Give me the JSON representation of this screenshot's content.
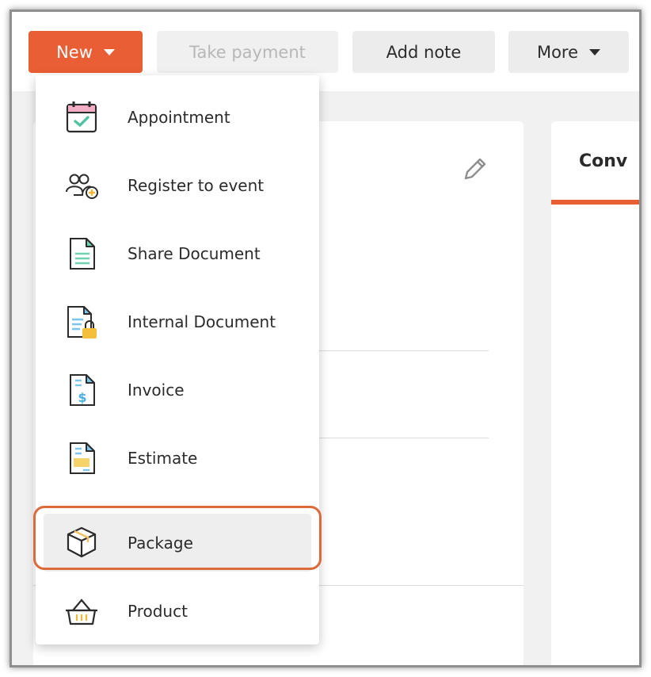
{
  "toolbar": {
    "new_label": "New",
    "take_payment_label": "Take payment",
    "add_note_label": "Add note",
    "more_label": "More"
  },
  "right_panel": {
    "tab_label": "Conv"
  },
  "colors": {
    "accent": "#e95e34",
    "highlight_ring": "#dc6a3a"
  },
  "menu": {
    "items": [
      {
        "label": "Appointment",
        "icon": "calendar-check-icon"
      },
      {
        "label": "Register to event",
        "icon": "users-add-icon"
      },
      {
        "label": "Share Document",
        "icon": "document-icon"
      },
      {
        "label": "Internal Document",
        "icon": "document-lock-icon"
      },
      {
        "label": "Invoice",
        "icon": "invoice-dollar-icon"
      },
      {
        "label": "Estimate",
        "icon": "estimate-icon"
      },
      {
        "label": "Package",
        "icon": "box-icon",
        "highlighted": true
      },
      {
        "label": "Product",
        "icon": "basket-icon"
      }
    ]
  }
}
